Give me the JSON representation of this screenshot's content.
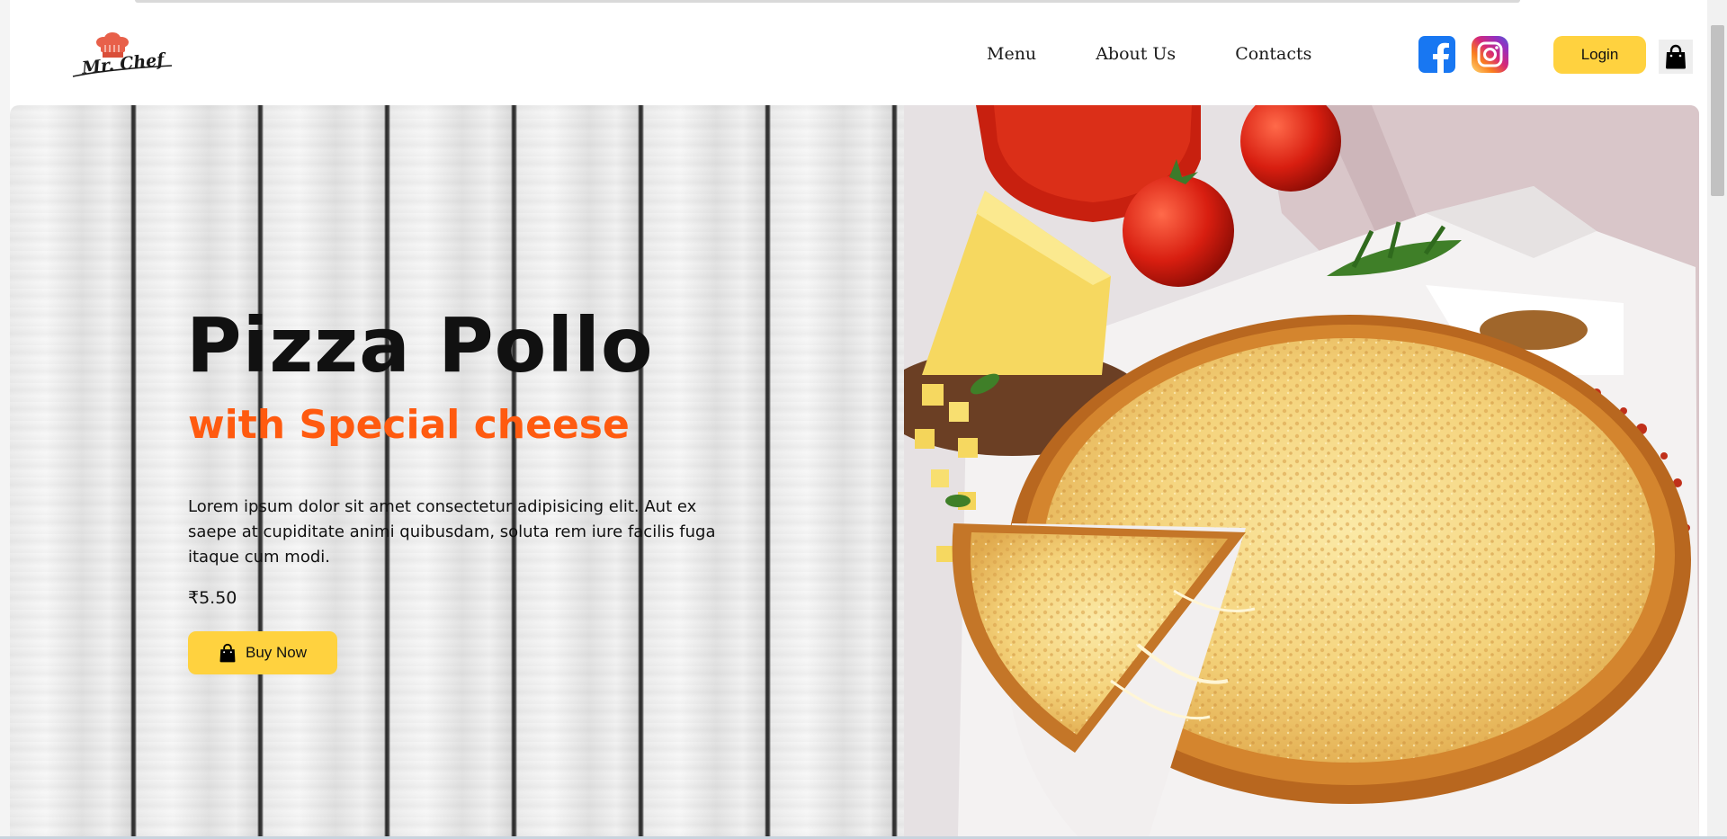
{
  "brand": {
    "logo_text": "Mr. Chef"
  },
  "nav": {
    "items": [
      {
        "label": "Menu"
      },
      {
        "label": "About Us"
      },
      {
        "label": "Contacts"
      }
    ]
  },
  "social": {
    "facebook_icon": "facebook-icon",
    "instagram_icon": "instagram-icon"
  },
  "header": {
    "login_label": "Login",
    "cart_icon": "shopping-bag-icon"
  },
  "hero": {
    "title": "Pizza Pollo",
    "subtitle": "with Special cheese",
    "description": "Lorem ipsum dolor sit amet consectetur adipisicing elit. Aut ex saepe at cupiditate animi quibusdam, soluta rem iure facilis fuga itaque cum modi.",
    "price": "₹5.50",
    "buy_label": "Buy Now",
    "buy_icon": "shopping-bag-icon"
  },
  "colors": {
    "accent_yellow": "#ffd23f",
    "subtitle_orange": "#ff5a0f",
    "facebook_blue": "#1877f2"
  }
}
